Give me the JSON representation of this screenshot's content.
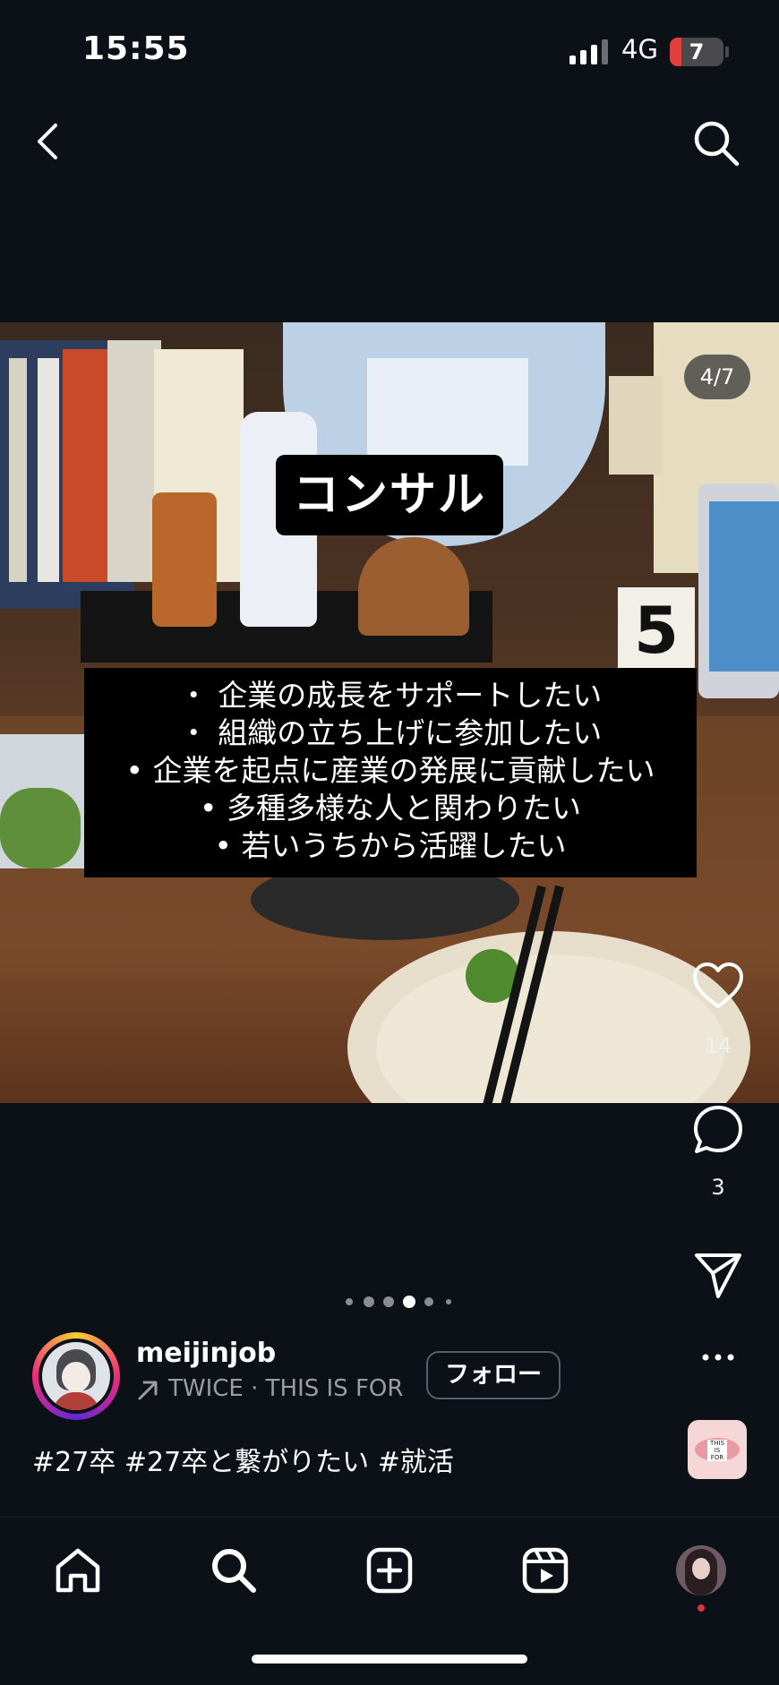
{
  "status": {
    "time": "15:55",
    "network": "4G",
    "battery": "7",
    "battery_fraction": 0.07
  },
  "post": {
    "counter": "4/7",
    "title": "コンサル",
    "bullets": [
      "・ 企業の成長をサポートしたい",
      "・ 組織の立ち上げに参加したい",
      "• 企業を起点に産業の発展に貢献したい",
      "• 多種多様な人と関わりたい",
      "• 若いうちから活躍したい"
    ],
    "likes": "14",
    "comments": "3",
    "username": "meijinjob",
    "music": "TWICE · THIS IS FOR",
    "follow_label": "フォロー",
    "hashtags": "#27卒 #27卒と繋がりたい #就活",
    "thumb_text": "THIS IS FOR"
  },
  "carousel": {
    "total": 6,
    "active": 3
  },
  "icons": {
    "back": "chevron-left-icon",
    "search": "search-icon",
    "like": "heart-icon",
    "comment": "comment-icon",
    "share": "send-icon",
    "more": "more-icon",
    "nav": [
      "home-icon",
      "search-icon",
      "create-icon",
      "reels-icon",
      "profile-avatar"
    ]
  },
  "colors": {
    "background": "#0c1017",
    "notification_dot": "#e0313b",
    "battery_low": "#e0403a"
  }
}
